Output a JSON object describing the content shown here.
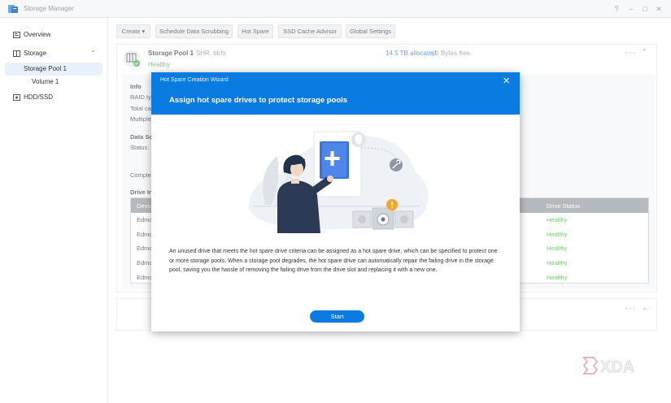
{
  "window": {
    "title": "Storage Manager"
  },
  "sidebar": {
    "items": [
      {
        "label": "Overview"
      },
      {
        "label": "Storage"
      },
      {
        "label": "Storage Pool 1"
      },
      {
        "label": "Volume 1"
      },
      {
        "label": "HDD/SSD"
      }
    ]
  },
  "toolbar": {
    "create": "Create",
    "schedule": "Schedule Data Scrubbing",
    "hot_spare": "Hot Spare",
    "ssd_cache": "SSD Cache Advisor",
    "global": "Global Settings"
  },
  "pool": {
    "name": "Storage Pool 1",
    "type": "- SHR, btrfs",
    "status": "Healthy",
    "allocated": "14.5 TB allocated",
    "free": "| 0 Bytes free"
  },
  "background": {
    "info": "Info",
    "raid": "RAID typ",
    "total": "Total cap",
    "multiple": "Multiple",
    "data_scrub": "Data Sc",
    "status": "Status:",
    "complete": "Complet",
    "drive_info": "Drive In",
    "device_col": "Devic",
    "drive_status_col": "Drive Status",
    "rows": [
      {
        "device": "Edmo",
        "status": "Healthy"
      },
      {
        "device": "Edmo",
        "status": "Healthy"
      },
      {
        "device": "Edmo",
        "status": "Healthy"
      },
      {
        "device": "Edmo",
        "status": "Healthy"
      },
      {
        "device": "Edmo",
        "status": "Healthy"
      }
    ]
  },
  "modal": {
    "header": "Hot Spare Creation Wizard",
    "title": "Assign hot spare drives to protect storage pools",
    "description": "An unused drive that meets the hot spare drive criteria can be assigned as a hot spare drive, which can be specified to protect one or more storage pools. When a storage pool degrades, the hot spare drive can automatically repair the failing drive in the storage pool, saving you the hassle of removing the failing drive from the drive slot and replacing it with a new one.",
    "start": "Start"
  },
  "watermark": {
    "text": "XDA"
  },
  "colors": {
    "accent": "#0a7be0",
    "healthy": "#3aa93a",
    "link": "#1a73e8"
  }
}
